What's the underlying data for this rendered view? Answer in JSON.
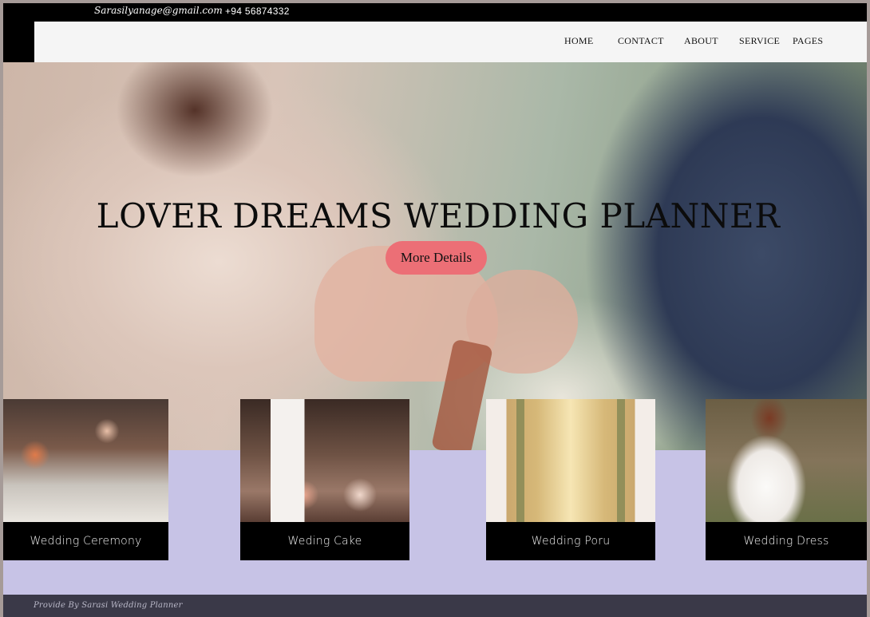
{
  "topbar": {
    "email": "Sarasilyanage@gmail.com",
    "phone": "+94 56874332"
  },
  "nav": {
    "items": [
      {
        "label": "HOME"
      },
      {
        "label": "CONTACT"
      },
      {
        "label": "ABOUT"
      },
      {
        "label": "SERVICE"
      },
      {
        "label": "PAGES"
      }
    ]
  },
  "hero": {
    "title": "LOVER DREAMS WEDDING PLANNER",
    "button_label": "More Details"
  },
  "cards": [
    {
      "label": "Wedding Ceremony"
    },
    {
      "label": "Weding Cake"
    },
    {
      "label": "Wedding Poru"
    },
    {
      "label": "Wedding Dress"
    }
  ],
  "footer": {
    "text": "Provide By Sarasi Wedding Planner"
  }
}
